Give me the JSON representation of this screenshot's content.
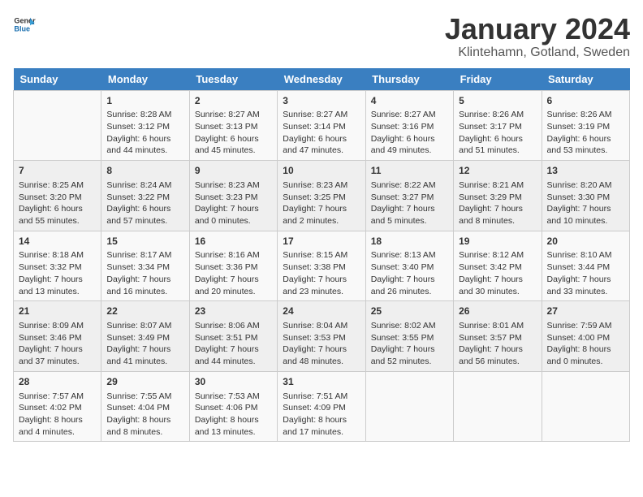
{
  "header": {
    "logo_general": "General",
    "logo_blue": "Blue",
    "title": "January 2024",
    "subtitle": "Klintehamn, Gotland, Sweden"
  },
  "days_of_week": [
    "Sunday",
    "Monday",
    "Tuesday",
    "Wednesday",
    "Thursday",
    "Friday",
    "Saturday"
  ],
  "weeks": [
    [
      {
        "day": "",
        "info": ""
      },
      {
        "day": "1",
        "info": "Sunrise: 8:28 AM\nSunset: 3:12 PM\nDaylight: 6 hours\nand 44 minutes."
      },
      {
        "day": "2",
        "info": "Sunrise: 8:27 AM\nSunset: 3:13 PM\nDaylight: 6 hours\nand 45 minutes."
      },
      {
        "day": "3",
        "info": "Sunrise: 8:27 AM\nSunset: 3:14 PM\nDaylight: 6 hours\nand 47 minutes."
      },
      {
        "day": "4",
        "info": "Sunrise: 8:27 AM\nSunset: 3:16 PM\nDaylight: 6 hours\nand 49 minutes."
      },
      {
        "day": "5",
        "info": "Sunrise: 8:26 AM\nSunset: 3:17 PM\nDaylight: 6 hours\nand 51 minutes."
      },
      {
        "day": "6",
        "info": "Sunrise: 8:26 AM\nSunset: 3:19 PM\nDaylight: 6 hours\nand 53 minutes."
      }
    ],
    [
      {
        "day": "7",
        "info": "Sunrise: 8:25 AM\nSunset: 3:20 PM\nDaylight: 6 hours\nand 55 minutes."
      },
      {
        "day": "8",
        "info": "Sunrise: 8:24 AM\nSunset: 3:22 PM\nDaylight: 6 hours\nand 57 minutes."
      },
      {
        "day": "9",
        "info": "Sunrise: 8:23 AM\nSunset: 3:23 PM\nDaylight: 7 hours\nand 0 minutes."
      },
      {
        "day": "10",
        "info": "Sunrise: 8:23 AM\nSunset: 3:25 PM\nDaylight: 7 hours\nand 2 minutes."
      },
      {
        "day": "11",
        "info": "Sunrise: 8:22 AM\nSunset: 3:27 PM\nDaylight: 7 hours\nand 5 minutes."
      },
      {
        "day": "12",
        "info": "Sunrise: 8:21 AM\nSunset: 3:29 PM\nDaylight: 7 hours\nand 8 minutes."
      },
      {
        "day": "13",
        "info": "Sunrise: 8:20 AM\nSunset: 3:30 PM\nDaylight: 7 hours\nand 10 minutes."
      }
    ],
    [
      {
        "day": "14",
        "info": "Sunrise: 8:18 AM\nSunset: 3:32 PM\nDaylight: 7 hours\nand 13 minutes."
      },
      {
        "day": "15",
        "info": "Sunrise: 8:17 AM\nSunset: 3:34 PM\nDaylight: 7 hours\nand 16 minutes."
      },
      {
        "day": "16",
        "info": "Sunrise: 8:16 AM\nSunset: 3:36 PM\nDaylight: 7 hours\nand 20 minutes."
      },
      {
        "day": "17",
        "info": "Sunrise: 8:15 AM\nSunset: 3:38 PM\nDaylight: 7 hours\nand 23 minutes."
      },
      {
        "day": "18",
        "info": "Sunrise: 8:13 AM\nSunset: 3:40 PM\nDaylight: 7 hours\nand 26 minutes."
      },
      {
        "day": "19",
        "info": "Sunrise: 8:12 AM\nSunset: 3:42 PM\nDaylight: 7 hours\nand 30 minutes."
      },
      {
        "day": "20",
        "info": "Sunrise: 8:10 AM\nSunset: 3:44 PM\nDaylight: 7 hours\nand 33 minutes."
      }
    ],
    [
      {
        "day": "21",
        "info": "Sunrise: 8:09 AM\nSunset: 3:46 PM\nDaylight: 7 hours\nand 37 minutes."
      },
      {
        "day": "22",
        "info": "Sunrise: 8:07 AM\nSunset: 3:49 PM\nDaylight: 7 hours\nand 41 minutes."
      },
      {
        "day": "23",
        "info": "Sunrise: 8:06 AM\nSunset: 3:51 PM\nDaylight: 7 hours\nand 44 minutes."
      },
      {
        "day": "24",
        "info": "Sunrise: 8:04 AM\nSunset: 3:53 PM\nDaylight: 7 hours\nand 48 minutes."
      },
      {
        "day": "25",
        "info": "Sunrise: 8:02 AM\nSunset: 3:55 PM\nDaylight: 7 hours\nand 52 minutes."
      },
      {
        "day": "26",
        "info": "Sunrise: 8:01 AM\nSunset: 3:57 PM\nDaylight: 7 hours\nand 56 minutes."
      },
      {
        "day": "27",
        "info": "Sunrise: 7:59 AM\nSunset: 4:00 PM\nDaylight: 8 hours\nand 0 minutes."
      }
    ],
    [
      {
        "day": "28",
        "info": "Sunrise: 7:57 AM\nSunset: 4:02 PM\nDaylight: 8 hours\nand 4 minutes."
      },
      {
        "day": "29",
        "info": "Sunrise: 7:55 AM\nSunset: 4:04 PM\nDaylight: 8 hours\nand 8 minutes."
      },
      {
        "day": "30",
        "info": "Sunrise: 7:53 AM\nSunset: 4:06 PM\nDaylight: 8 hours\nand 13 minutes."
      },
      {
        "day": "31",
        "info": "Sunrise: 7:51 AM\nSunset: 4:09 PM\nDaylight: 8 hours\nand 17 minutes."
      },
      {
        "day": "",
        "info": ""
      },
      {
        "day": "",
        "info": ""
      },
      {
        "day": "",
        "info": ""
      }
    ]
  ]
}
